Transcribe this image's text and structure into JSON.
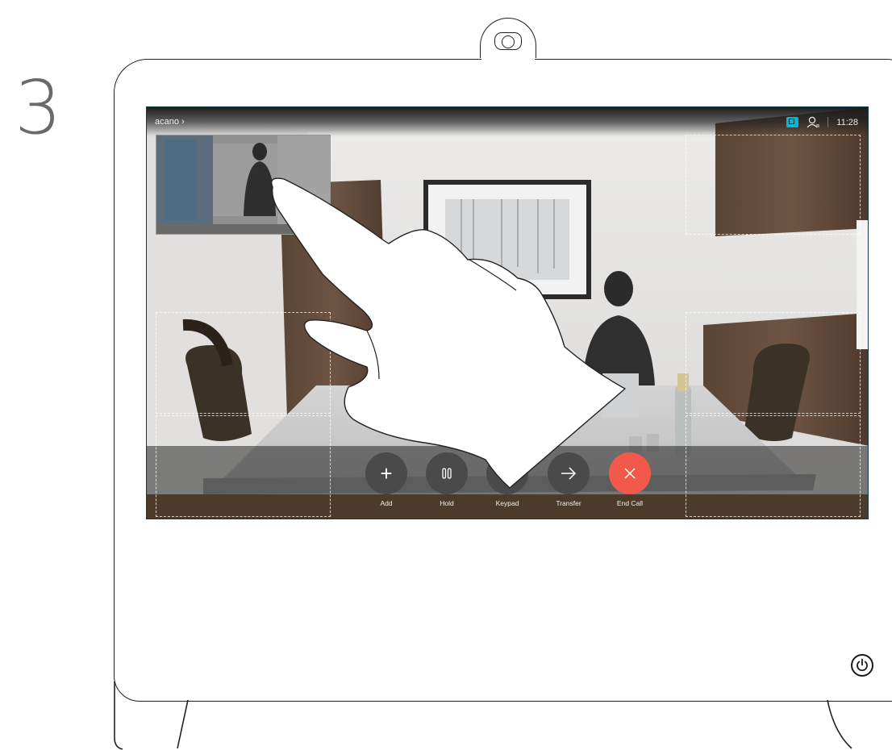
{
  "step": {
    "number": "3"
  },
  "call": {
    "caller_name": "acano",
    "caller_chevron": "›",
    "clock": "11:28"
  },
  "controls": [
    {
      "id": "add",
      "label": "Add",
      "icon": "plus-icon"
    },
    {
      "id": "hold",
      "label": "Hold",
      "icon": "pause-icon"
    },
    {
      "id": "keypad",
      "label": "Keypad",
      "icon": "keypad-icon"
    },
    {
      "id": "transfer",
      "label": "Transfer",
      "icon": "arrow-right-icon"
    },
    {
      "id": "end",
      "label": "End Call",
      "icon": "close-icon"
    }
  ],
  "colors": {
    "end_call": "#f15a4a",
    "selfview_active": "#07b5d4",
    "button": "#4a4a4a"
  },
  "icons": {
    "selfview": "selfview-icon",
    "participants": "participants-icon",
    "power": "power-icon",
    "camera": "camera-icon",
    "hand": "pointing-hand-icon"
  }
}
